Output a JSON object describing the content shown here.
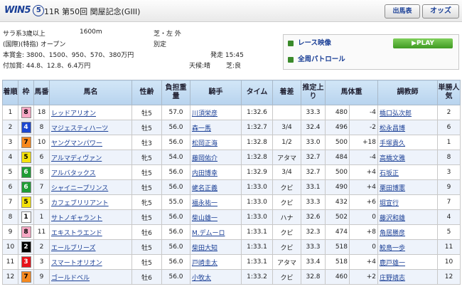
{
  "header": {
    "logo_text": "WIN5",
    "logo_num": "5",
    "race_title": "11R 第50回 関屋記念(GIII)",
    "btn_entries": "出馬表",
    "btn_odds": "オッズ"
  },
  "info": {
    "line1_left": "サラ系3歳以上",
    "distance": "1600m",
    "course": "芝・左 外",
    "line2_left": "(国際)(特指) オープン",
    "weight_rule": "別定",
    "prize": "本賞金: 3800、1500、950、570、380万円",
    "post_time": "発走 15:45",
    "add_prize": "付加賞: 44.8、12.8、6.4万円",
    "weather": "天候:晴",
    "track": "芝:良"
  },
  "panel": {
    "video_label": "レース映像",
    "play_label": "▶PLAY",
    "patrol_label": "全周パトロール"
  },
  "columns": [
    "着順",
    "枠",
    "馬番",
    "馬名",
    "性齢",
    "負担重量",
    "騎手",
    "タイム",
    "着差",
    "推定上り",
    "馬体重",
    "",
    "調教師",
    "単勝人気"
  ],
  "rows": [
    {
      "pos": "1",
      "waku": "8",
      "num": "18",
      "horse": "レッドアリオン",
      "sexage": "牡5",
      "weight": "57.0",
      "jockey": "川須栄彦",
      "time": "1:32.6",
      "margin": "",
      "last3f": "33.3",
      "bw": "480",
      "diff": "-4",
      "trainer": "橋口弘次郎",
      "pop": "2"
    },
    {
      "pos": "2",
      "waku": "4",
      "num": "8",
      "horse": "マジェスティハーツ",
      "sexage": "牡5",
      "weight": "56.0",
      "jockey": "森一馬",
      "time": "1:32.7",
      "margin": "3/4",
      "last3f": "32.4",
      "bw": "496",
      "diff": "-2",
      "trainer": "松永昌博",
      "pop": "6"
    },
    {
      "pos": "3",
      "waku": "7",
      "num": "10",
      "horse": "ヤングマンパワー",
      "sexage": "牡3",
      "weight": "56.0",
      "jockey": "松岡正海",
      "time": "1:32.8",
      "margin": "1/2",
      "last3f": "33.0",
      "bw": "500",
      "diff": "+18",
      "trainer": "手塚貴久",
      "pop": "1"
    },
    {
      "pos": "4",
      "waku": "5",
      "num": "6",
      "horse": "アルマディヴァン",
      "sexage": "牝5",
      "weight": "54.0",
      "jockey": "藤岡佑介",
      "time": "1:32.8",
      "margin": "アタマ",
      "last3f": "32.7",
      "bw": "484",
      "diff": "-4",
      "trainer": "高橋文雅",
      "pop": "8"
    },
    {
      "pos": "5",
      "waku": "6",
      "num": "8",
      "horse": "アルバタックス",
      "sexage": "牡5",
      "weight": "56.0",
      "jockey": "内田博幸",
      "time": "1:32.9",
      "margin": "3/4",
      "last3f": "32.7",
      "bw": "500",
      "diff": "+4",
      "trainer": "石坂正",
      "pop": "3"
    },
    {
      "pos": "6",
      "waku": "6",
      "num": "7",
      "horse": "シャイニープリンス",
      "sexage": "牡5",
      "weight": "56.0",
      "jockey": "蛯名正義",
      "time": "1:33.0",
      "margin": "クビ",
      "last3f": "33.1",
      "bw": "490",
      "diff": "+4",
      "trainer": "栗田博憲",
      "pop": "9"
    },
    {
      "pos": "7",
      "waku": "5",
      "num": "5",
      "horse": "カフェブリリアント",
      "sexage": "牝5",
      "weight": "55.0",
      "jockey": "福永祐一",
      "time": "1:33.0",
      "margin": "クビ",
      "last3f": "33.3",
      "bw": "432",
      "diff": "+6",
      "trainer": "堀宣行",
      "pop": "7"
    },
    {
      "pos": "8",
      "waku": "1",
      "num": "1",
      "horse": "サトノギャラント",
      "sexage": "牡5",
      "weight": "56.0",
      "jockey": "柴山雄一",
      "time": "1:33.0",
      "margin": "ハナ",
      "last3f": "32.6",
      "bw": "502",
      "diff": "0",
      "trainer": "藤沢和雄",
      "pop": "4"
    },
    {
      "pos": "9",
      "waku": "8",
      "num": "11",
      "horse": "エキストラエンド",
      "sexage": "牡6",
      "weight": "56.0",
      "jockey": "M.デムーロ",
      "time": "1:33.1",
      "margin": "クビ",
      "last3f": "32.3",
      "bw": "474",
      "diff": "+8",
      "trainer": "角居勝彦",
      "pop": "5"
    },
    {
      "pos": "10",
      "waku": "2",
      "num": "2",
      "horse": "エールブリーズ",
      "sexage": "牡5",
      "weight": "56.0",
      "jockey": "柴田大知",
      "time": "1:33.1",
      "margin": "クビ",
      "last3f": "33.3",
      "bw": "518",
      "diff": "0",
      "trainer": "鮫島一歩",
      "pop": "11"
    },
    {
      "pos": "11",
      "waku": "3",
      "num": "3",
      "horse": "スマートオリオン",
      "sexage": "牡5",
      "weight": "56.0",
      "jockey": "戸崎圭太",
      "time": "1:33.1",
      "margin": "アタマ",
      "last3f": "33.4",
      "bw": "518",
      "diff": "+4",
      "trainer": "鹿戸雄一",
      "pop": "10"
    },
    {
      "pos": "12",
      "waku": "7",
      "num": "9",
      "horse": "ゴールドベル",
      "sexage": "牡6",
      "weight": "56.0",
      "jockey": "小牧太",
      "time": "1:33.2",
      "margin": "クビ",
      "last3f": "32.8",
      "bw": "460",
      "diff": "+2",
      "trainer": "庄野靖志",
      "pop": "12"
    }
  ],
  "waku_colors": {
    "1": {
      "bg": "#ffffff",
      "fg": "#000000"
    },
    "2": {
      "bg": "#000000",
      "fg": "#ffffff"
    },
    "3": {
      "bg": "#e8131b",
      "fg": "#ffffff"
    },
    "4": {
      "bg": "#1a46d1",
      "fg": "#ffffff"
    },
    "5": {
      "bg": "#f4e20b",
      "fg": "#000000"
    },
    "6": {
      "bg": "#1f9c35",
      "fg": "#ffffff"
    },
    "7": {
      "bg": "#f6891f",
      "fg": "#000000"
    },
    "8": {
      "bg": "#f7a8c4",
      "fg": "#000000"
    }
  }
}
